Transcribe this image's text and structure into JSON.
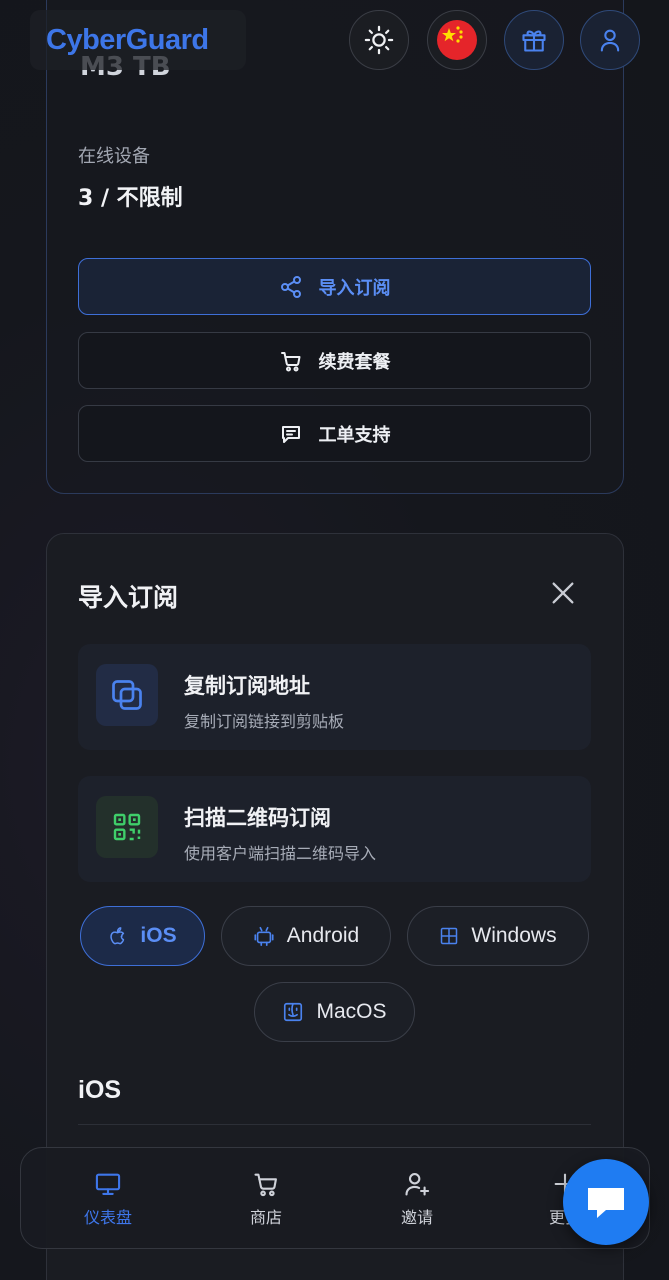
{
  "header": {
    "brand": "CyberGuard",
    "icons": [
      "sun-icon",
      "china-flag-icon",
      "gift-icon",
      "user-icon"
    ]
  },
  "account": {
    "cut_text": "M3 TB",
    "devices_label": "在线设备",
    "devices_value": "3 / 不限制",
    "buttons": [
      {
        "label": "导入订阅",
        "icon": "share-icon"
      },
      {
        "label": "续费套餐",
        "icon": "cart-icon"
      },
      {
        "label": "工单支持",
        "icon": "message-icon"
      }
    ]
  },
  "import_panel": {
    "title": "导入订阅",
    "options": [
      {
        "title": "复制订阅地址",
        "subtitle": "复制订阅链接到剪贴板",
        "icon": "copy-icon"
      },
      {
        "title": "扫描二维码订阅",
        "subtitle": "使用客户端扫描二维码导入",
        "icon": "qr-code-icon"
      }
    ],
    "platforms": [
      "iOS",
      "Android",
      "Windows",
      "MacOS"
    ],
    "selected_platform": "iOS",
    "section_title": "iOS"
  },
  "bottom_nav": {
    "items": [
      {
        "label": "仪表盘",
        "icon": "monitor-icon",
        "active": true
      },
      {
        "label": "商店",
        "icon": "cart-icon",
        "active": false
      },
      {
        "label": "邀请",
        "icon": "user-plus-icon",
        "active": false
      },
      {
        "label": "更多",
        "icon": "plus-icon",
        "active": false
      }
    ]
  },
  "colors": {
    "accent": "#3e76ea",
    "background": "#15171d",
    "card": "#1a1c22",
    "qr_green": "#3fcf6a",
    "chat_fab": "#1f7cf2"
  }
}
